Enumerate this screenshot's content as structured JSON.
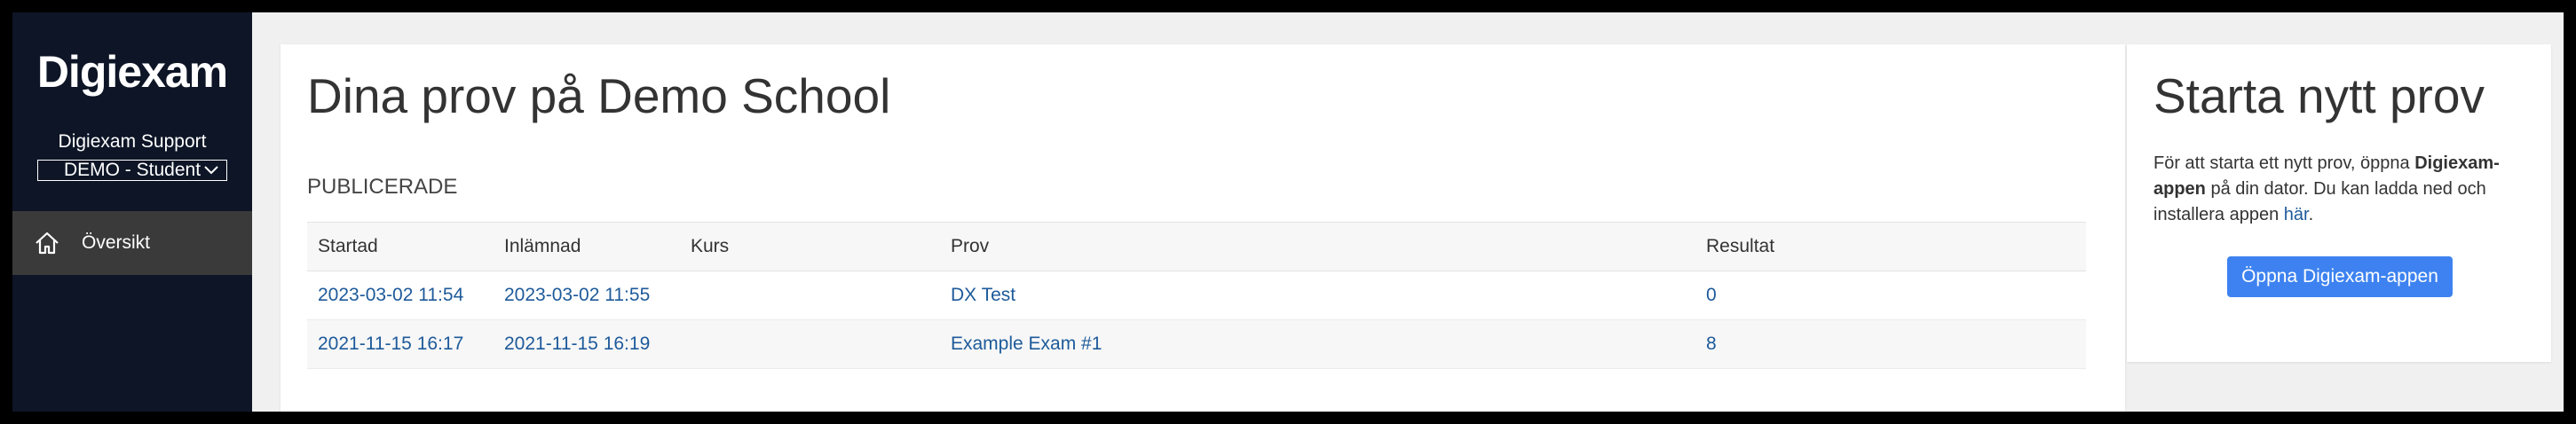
{
  "sidebar": {
    "logo": "Digiexam",
    "org_name": "Digiexam Support",
    "role_select": "DEMO - Student",
    "nav": [
      {
        "label": "Översikt",
        "icon": "home-icon"
      }
    ]
  },
  "main": {
    "title": "Dina prov på Demo School",
    "section_label": "PUBLICERADE",
    "columns": [
      "Startad",
      "Inlämnad",
      "Kurs",
      "Prov",
      "Resultat"
    ],
    "rows": [
      {
        "startad": "2023-03-02 11:54",
        "inlamnad": "2023-03-02 11:55",
        "kurs": "",
        "prov": "DX Test",
        "resultat": "0"
      },
      {
        "startad": "2021-11-15 16:17",
        "inlamnad": "2021-11-15 16:19",
        "kurs": "",
        "prov": "Example Exam #1",
        "resultat": "8"
      }
    ]
  },
  "side": {
    "title": "Starta nytt prov",
    "text_1": "För att starta ett nytt prov, öppna ",
    "text_bold": "Digiexam-appen",
    "text_2": " på din dator. Du kan ladda ned och installera appen ",
    "link": "här",
    "text_3": ".",
    "button": "Öppna Digiexam-appen"
  },
  "colors": {
    "sidebar_bg": "#0d1526",
    "nav_active_bg": "#3a3a3a",
    "link": "#1d5a9a",
    "button": "#3d82f0",
    "page_bg": "#f0f0f0"
  }
}
